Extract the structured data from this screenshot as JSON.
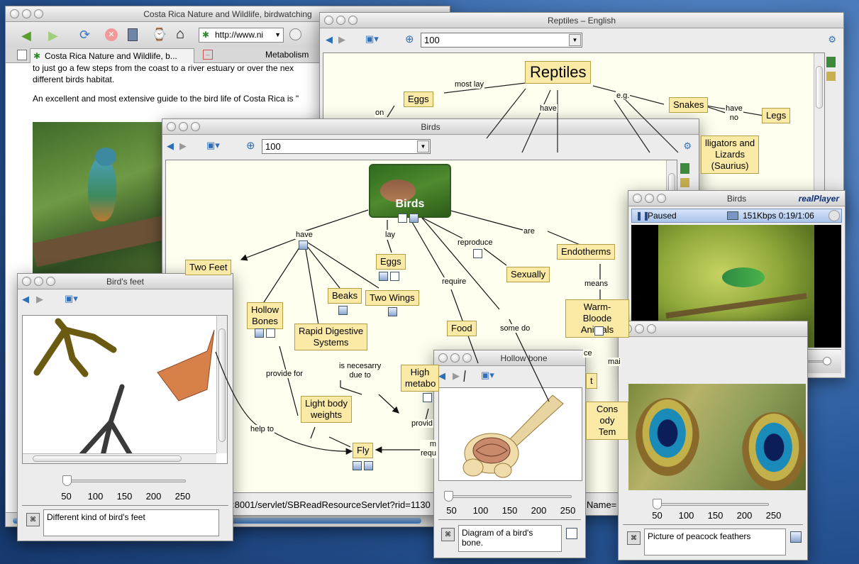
{
  "desktop": {
    "color": "#1f4f8e"
  },
  "browser": {
    "title": "Costa Rica Nature and Wildlife, birdwatching",
    "url": "http://www.ni",
    "tabs": [
      "Costa Rica Nature and Wildlife, b...",
      "Metabolism"
    ],
    "text1": "to just go a few steps from the coast to a river estuary or over the nex",
    "text2": "different birds habitat.",
    "text3": "An excellent and most extensive guide to the bird life of Costa Rica is \"",
    "status": ":8001/servlet/SBReadResourceServlet?rid=1130",
    "status2": "Name="
  },
  "reptiles": {
    "title": "Reptiles – English",
    "zoom": "100",
    "nodes": {
      "reptiles": "Reptiles",
      "eggs": "Eggs",
      "snakes": "Snakes",
      "legs": "Legs",
      "alligators": "lligators and\nLizards\n(Saurius)"
    },
    "labels": {
      "most_lay": "most lay",
      "on": "on",
      "have": "have",
      "eg": "e.g.",
      "have_no": "have\nno"
    }
  },
  "birds": {
    "title": "Birds",
    "zoom": "100",
    "center": "Birds",
    "nodes": {
      "two_feet": "Two Feet",
      "hollow_bones": "Hollow\nBones",
      "beaks": "Beaks",
      "two_wings": "Two Wings",
      "eggs": "Eggs",
      "sexually": "Sexually",
      "endotherms": "Endotherms",
      "warm_blooded": "Warm-Bloode\nAnimals",
      "rapid": "Rapid Digestive\nSystems",
      "food": "Food",
      "high_metab": "High\nmetabo",
      "light_body": "Light body\nweights",
      "fly": "Fly",
      "const": "Cons\nody Tem",
      "t_node": "t"
    },
    "labels": {
      "have": "have",
      "lay": "lay",
      "reproduce": "reproduce",
      "are": "are",
      "require": "require",
      "some_do": "some do",
      "means": "means",
      "provide_for": "provide for",
      "is_necessary": "is necesarry\ndue to",
      "help_to": "help to",
      "provid": "provid",
      "requ": "m\nrequ",
      "ce": "ce",
      "mai": "mai"
    }
  },
  "birdsfeet": {
    "title": "Bird's feet",
    "ticks": [
      "50",
      "100",
      "150",
      "200",
      "250"
    ],
    "slider_value": 0,
    "description": "Different kind of bird's feet"
  },
  "player": {
    "title": "Birds",
    "brand": "realPlayer",
    "status": "Paused",
    "rate": "151Kbps 0:19/1:06",
    "progress": 0.29
  },
  "hollowbone": {
    "title": "Hollow bone",
    "ticks": [
      "50",
      "100",
      "150",
      "200",
      "250"
    ],
    "slider_value": 0,
    "description": "Diagram of a bird's\nbone."
  },
  "peacock": {
    "ticks": [
      "50",
      "100",
      "150",
      "200",
      "250"
    ],
    "slider_value": 0,
    "description": "Picture of peacock feathers"
  }
}
